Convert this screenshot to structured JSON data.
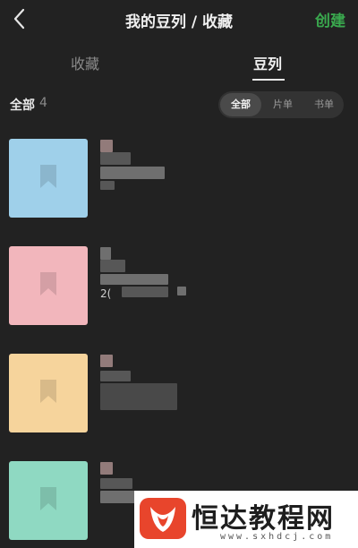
{
  "header": {
    "back_icon": "chevron-left-icon",
    "title": "我的豆列 / 收藏",
    "create_label": "创建",
    "accent_color": "#3aa84e"
  },
  "tabs": [
    {
      "label": "收藏",
      "active": false
    },
    {
      "label": "豆列",
      "active": true
    }
  ],
  "filter": {
    "all_label": "全部",
    "count": "4",
    "segments": [
      {
        "label": "全部",
        "selected": true
      },
      {
        "label": "片单",
        "selected": false
      },
      {
        "label": "书单",
        "selected": false
      }
    ]
  },
  "list": {
    "items": [
      {
        "cover_color": "#9fd0ea",
        "icon": "bookmark-icon",
        "count_text": ""
      },
      {
        "cover_color": "#f2b6bc",
        "icon": "bookmark-icon",
        "count_text": "2("
      },
      {
        "cover_color": "#f6d49c",
        "icon": "bookmark-icon",
        "count_text": ""
      },
      {
        "cover_color": "#8fd9c2",
        "icon": "bookmark-icon",
        "count_text": ""
      }
    ]
  },
  "watermark": {
    "text": "恒达教程网",
    "url": "www.sxhdcj.com",
    "brand_color": "#e8452c"
  }
}
